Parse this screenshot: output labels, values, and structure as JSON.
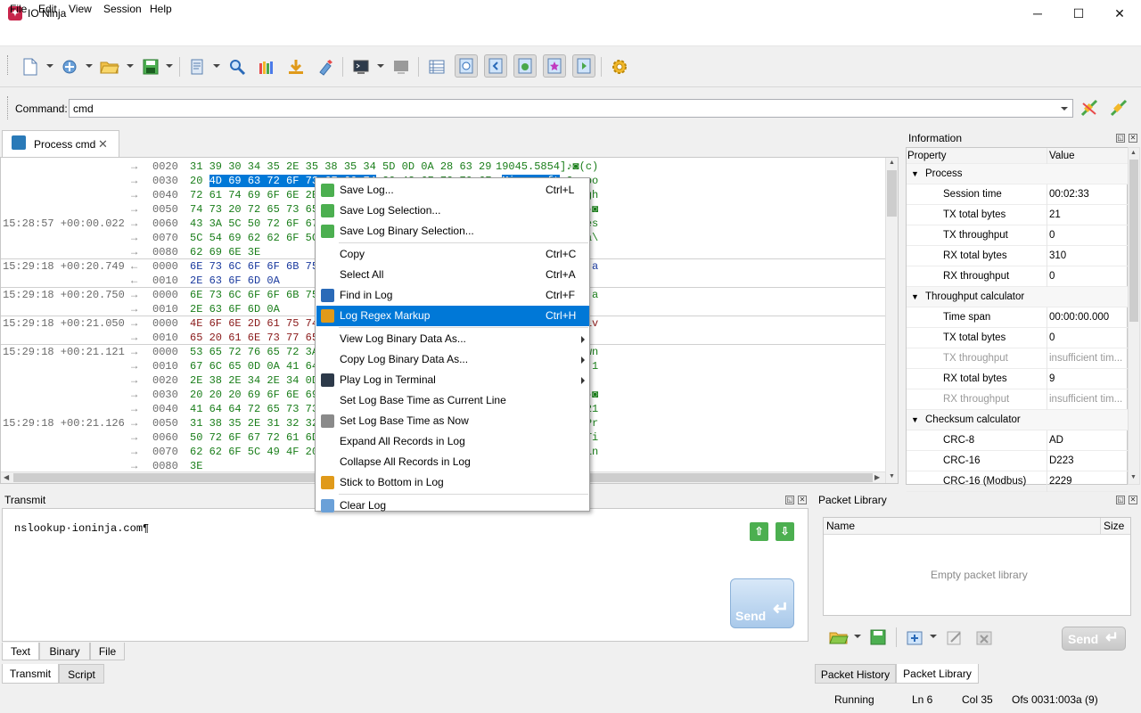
{
  "window": {
    "title": "IO Ninja",
    "minimize": "─",
    "maximize": "☐",
    "close": "✕"
  },
  "menu": [
    "File",
    "Edit",
    "View",
    "Session",
    "Help"
  ],
  "command": {
    "label": "Command:",
    "value": "cmd"
  },
  "session_tab": {
    "label": "Process cmd",
    "close": "✕"
  },
  "log": [
    {
      "ts": "",
      "dir": "→",
      "offset": "0020",
      "hex": "31 39 30 34 35 2E 35 38 35 34 5D 0D 0A 28 63 29",
      "ascii": "19045.5854]♪◙(c)",
      "kind": "rx"
    },
    {
      "ts": "",
      "dir": "→",
      "offset": "0030",
      "hex": "20 4D 69 63 72 6F 73 6F 66 74 20 43 6F 72 70 6F",
      "ascii": " Microsoft Corpo",
      "kind": "rx"
    },
    {
      "ts": "",
      "dir": "→",
      "offset": "0040",
      "hex": "72 61 74 69 6F 6E 2E 20 41 6C 6C 20 72 69 67 68",
      "ascii": "ration. All righ",
      "kind": "rx"
    },
    {
      "ts": "",
      "dir": "→",
      "offset": "0050",
      "hex": "74 73 20 72 65 73 65 72 76 65 64 2E 0D 0A 0D 0A",
      "ascii": "ts reserved.♪◙♪◙",
      "kind": "rx"
    },
    {
      "ts": "15:28:57 +00:00.022",
      "dir": "→",
      "offset": "0060",
      "hex": "43 3A 5C 50 72 6F 67 72 61 6D 20 46 69 6C 65 73",
      "ascii": "C:\\Program Files",
      "kind": "rx"
    },
    {
      "ts": "",
      "dir": "→",
      "offset": "0070",
      "hex": "5C 54 69 62 62 6F 5C 49 4F 20 4E 69 6E 6A 61 5C",
      "ascii": "\\Tibbo\\IO Ninja\\",
      "kind": "rx"
    },
    {
      "ts": "",
      "dir": "→",
      "offset": "0080",
      "hex": "62 69 6E 3E",
      "ascii": "bin>",
      "kind": "rx"
    },
    {
      "ts": "15:29:18 +00:20.749",
      "dir": "←",
      "offset": "0000",
      "hex": "6E 73 6C 6F 6F 6B 75 70 20 69 6F 6E 69 6E 6A 61",
      "ascii": "nslookup ioninja",
      "kind": "tx"
    },
    {
      "ts": "",
      "dir": "←",
      "offset": "0010",
      "hex": "2E 63 6F 6D 0A",
      "ascii": ".com◙",
      "kind": "tx"
    },
    {
      "ts": "15:29:18 +00:20.750",
      "dir": "→",
      "offset": "0000",
      "hex": "6E 73 6C 6F 6F 6B 75 70 20 69 6F 6E 69 6E 6A 61",
      "ascii": "nslookup ioninja",
      "kind": "rx"
    },
    {
      "ts": "",
      "dir": "→",
      "offset": "0010",
      "hex": "2E 63 6F 6D 0A",
      "ascii": ".com◙",
      "kind": "rx"
    },
    {
      "ts": "15:29:18 +00:21.050",
      "dir": "→",
      "offset": "0000",
      "hex": "4E 6F 6E 2D 61 75 74 68 6F 72 69 74 61 74 69 76",
      "ascii": "Non-authoritativ",
      "kind": "rxr"
    },
    {
      "ts": "",
      "dir": "→",
      "offset": "0010",
      "hex": "65 20 61 6E 73 77 65 72 3A 0D 0A",
      "ascii": "e answer:♪◙",
      "kind": "rxr"
    },
    {
      "ts": "15:29:18 +00:21.121",
      "dir": "→",
      "offset": "0000",
      "hex": "53 65 72 76 65 72 3A 20 20 55 6E 4B 6E 6F 77 6E",
      "ascii": "Server:  UnKnown",
      "kind": "rx"
    },
    {
      "ts": "",
      "dir": "→",
      "offset": "0010",
      "hex": "67 6C 65 0D 0A 41 64 64 72 65 73 73 3A 20 20 31",
      "ascii": "gle♪◙Address:  1",
      "kind": "rx"
    },
    {
      "ts": "",
      "dir": "→",
      "offset": "0020",
      "hex": "2E 38 2E 34 2E 34 0D 0A 0D 0A 4E 61 6D 65 3A 20",
      "ascii": ".8.4.4♪◙♪◙Name: ",
      "kind": "rx"
    },
    {
      "ts": "",
      "dir": "→",
      "offset": "0030",
      "hex": "20 20 20 69 6F 6E 69 6E 6A 61 2E 63 6F 6D 0D 0A",
      "ascii": "   ioninja.com♪◙",
      "kind": "rx"
    },
    {
      "ts": "",
      "dir": "→",
      "offset": "0040",
      "hex": "41 64 64 72 65 73 73 3A 20 20 31 30 34 2E 32 31",
      "ascii": "Address:  104.21",
      "kind": "rx"
    },
    {
      "ts": "15:29:18 +00:21.126",
      "dir": "→",
      "offset": "0050",
      "hex": "31 38 35 2E 31 32 32 0D 0A 0D 0A 43 3A 5C 50 72",
      "ascii": "185.122♪◙♪◙C:\\Pr",
      "kind": "rx"
    },
    {
      "ts": "",
      "dir": "→",
      "offset": "0060",
      "hex": "50 72 6F 67 72 61 6D 20 46 69 6C 65 73 5C 54 69",
      "ascii": "Program Files\\Ti",
      "kind": "rx"
    },
    {
      "ts": "",
      "dir": "→",
      "offset": "0070",
      "hex": "62 62 6F 5C 49 4F 20 4E 69 6E 6A 61 5C 62 69 6E",
      "ascii": "bbo\\IO Ninja\\bin",
      "kind": "rx"
    },
    {
      "ts": "",
      "dir": "→",
      "offset": "0080",
      "hex": "3E",
      "ascii": ">",
      "kind": "rx"
    }
  ],
  "information": {
    "title": "Information",
    "header_property": "Property",
    "header_value": "Value",
    "rows": [
      {
        "name": "Process",
        "value": "",
        "cat": true
      },
      {
        "name": "Session time",
        "value": "00:02:33"
      },
      {
        "name": "TX total bytes",
        "value": "21"
      },
      {
        "name": "TX throughput",
        "value": "0"
      },
      {
        "name": "RX total bytes",
        "value": "310"
      },
      {
        "name": "RX throughput",
        "value": "0"
      },
      {
        "name": "Throughput calculator",
        "value": "",
        "cat": true
      },
      {
        "name": "Time span",
        "value": "00:00:00.000"
      },
      {
        "name": "TX total bytes",
        "value": "0"
      },
      {
        "name": "TX throughput",
        "value": "insufficient tim...",
        "dis": true
      },
      {
        "name": "RX total bytes",
        "value": "9"
      },
      {
        "name": "RX throughput",
        "value": "insufficient tim...",
        "dis": true
      },
      {
        "name": "Checksum calculator",
        "value": "",
        "cat": true
      },
      {
        "name": "CRC-8",
        "value": "AD"
      },
      {
        "name": "CRC-16",
        "value": "D223"
      },
      {
        "name": "CRC-16 (Modbus)",
        "value": "2229"
      }
    ]
  },
  "transmit": {
    "title": "Transmit",
    "text": "nslookup·ioninja.com¶",
    "send": "Send",
    "tabs": [
      "Text",
      "Binary",
      "File"
    ],
    "lower_tabs": [
      "Transmit",
      "Script"
    ]
  },
  "packet_library": {
    "title": "Packet Library",
    "col_name": "Name",
    "col_size": "Size",
    "empty": "Empty packet library",
    "send": "Send",
    "lower_tabs": [
      "Packet History",
      "Packet Library"
    ]
  },
  "status": {
    "state": "Running",
    "line": "Ln 6",
    "col": "Col 35",
    "offset": "Ofs 0031:003a (9)"
  },
  "context_menu": [
    {
      "label": "Save Log...",
      "shortcut": "Ctrl+L",
      "icon": "save-log-icon"
    },
    {
      "label": "Save Log Selection...",
      "shortcut": "",
      "icon": "save-selection-icon"
    },
    {
      "label": "Save Log Binary Selection...",
      "shortcut": "",
      "icon": "save-binary-icon"
    },
    {
      "sep": true
    },
    {
      "label": "Copy",
      "shortcut": "Ctrl+C"
    },
    {
      "label": "Select All",
      "shortcut": "Ctrl+A"
    },
    {
      "label": "Find in Log",
      "shortcut": "Ctrl+F",
      "icon": "find-icon"
    },
    {
      "label": "Log Regex Markup",
      "shortcut": "Ctrl+H",
      "icon": "regex-markup-icon",
      "hl": true
    },
    {
      "sep": true
    },
    {
      "label": "View Log Binary Data As...",
      "shortcut": "",
      "submenu": true
    },
    {
      "label": "Copy Log Binary Data As...",
      "shortcut": "",
      "submenu": true
    },
    {
      "label": "Play Log in Terminal",
      "shortcut": "",
      "submenu": true,
      "icon": "terminal-icon"
    },
    {
      "label": "Set Log Base Time as Current Line",
      "shortcut": ""
    },
    {
      "label": "Set Log Base Time as Now",
      "shortcut": "",
      "icon": "stopwatch-icon"
    },
    {
      "label": "Expand All Records in Log",
      "shortcut": ""
    },
    {
      "label": "Collapse All Records in Log",
      "shortcut": ""
    },
    {
      "label": "Stick to Bottom in Log",
      "shortcut": "",
      "icon": "stick-bottom-icon"
    },
    {
      "sep": true
    },
    {
      "label": "Clear Log",
      "shortcut": "",
      "icon": "clear-log-icon"
    }
  ],
  "colors": {
    "accent": "#0078d7",
    "rx": "#1a7e1a",
    "tx": "#1a3a9e",
    "brand": "#c8254b"
  }
}
